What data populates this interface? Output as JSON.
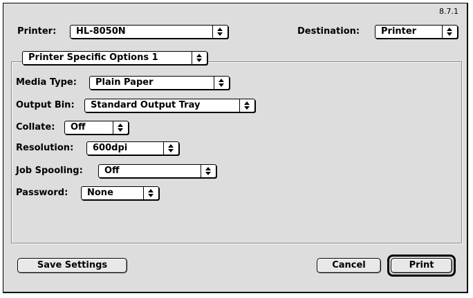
{
  "version": "8.7.1",
  "printer": {
    "label": "Printer:",
    "value": "HL-8050N"
  },
  "destination": {
    "label": "Destination:",
    "value": "Printer"
  },
  "panel": {
    "value": "Printer Specific Options 1"
  },
  "options": [
    {
      "label": "Media Type:",
      "value": "Plain Paper"
    },
    {
      "label": "Output Bin:",
      "value": "Standard Output Tray"
    },
    {
      "label": "Collate:",
      "value": "Off"
    },
    {
      "label": "Resolution:",
      "value": "600dpi"
    },
    {
      "label": "Job Spooling:",
      "value": "Off"
    },
    {
      "label": "Password:",
      "value": "None"
    }
  ],
  "buttons": {
    "save_settings": "Save Settings",
    "cancel": "Cancel",
    "print": "Print"
  },
  "icons": {
    "popup_arrow": "up-down-arrows-icon"
  }
}
